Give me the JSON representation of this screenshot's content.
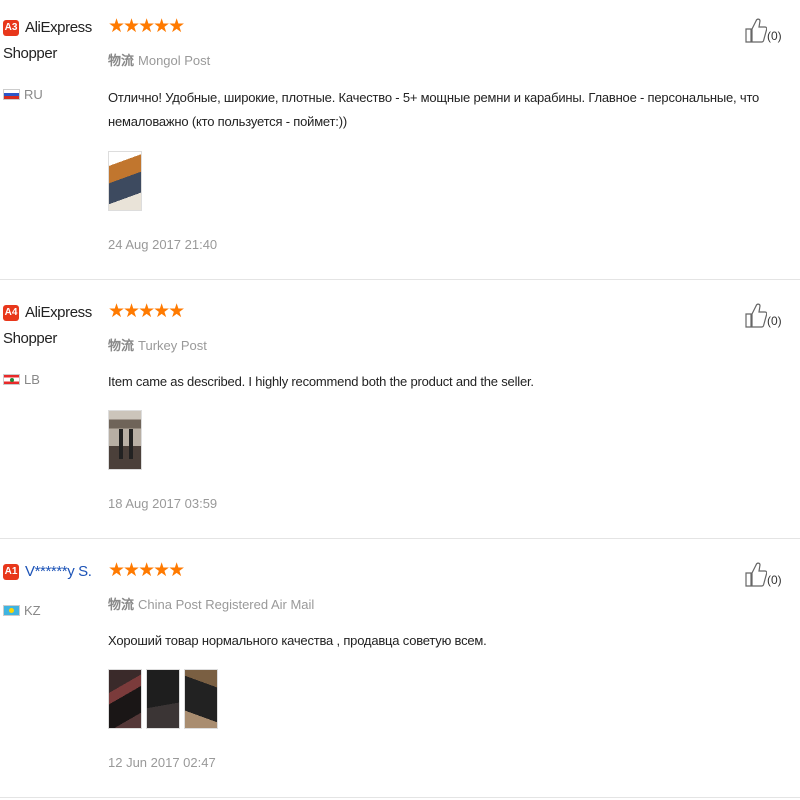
{
  "reviews": [
    {
      "badge": "A3",
      "name_line1": "AliExpress",
      "name_line2": "Shopper",
      "country": "RU",
      "flag": "ru-flag-icon",
      "stars": "★★★★★",
      "logistics_label": "物流",
      "logistics": "Mongol Post",
      "text": "Отлично! Удобные, широкие, плотные. Качество - 5+ мощные ремни и карабины. Главное - персональные, что немаловажно (кто пользуется - поймет:))",
      "date": "24 Aug 2017 21:40",
      "likes": "(0)"
    },
    {
      "badge": "A4",
      "name_line1": "AliExpress",
      "name_line2": "Shopper",
      "country": "LB",
      "flag": "lb-flag-icon",
      "stars": "★★★★★",
      "logistics_label": "物流",
      "logistics": "Turkey Post",
      "text": "Item came as described. I highly recommend both the product and the seller.",
      "date": "18 Aug 2017 03:59",
      "likes": "(0)"
    },
    {
      "badge": "A1",
      "name_line1": "V******y S.",
      "name_line2": "",
      "country": "KZ",
      "flag": "kz-flag-icon",
      "stars": "★★★★★",
      "logistics_label": "物流",
      "logistics": "China Post Registered Air Mail",
      "text": "Хороший товар нормального качества , продавца советую всем.",
      "date": "12 Jun 2017 02:47",
      "likes": "(0)"
    }
  ],
  "colors": {
    "stars": "#ff7a00",
    "badge": "#e8371b",
    "link": "#1c53b7"
  }
}
